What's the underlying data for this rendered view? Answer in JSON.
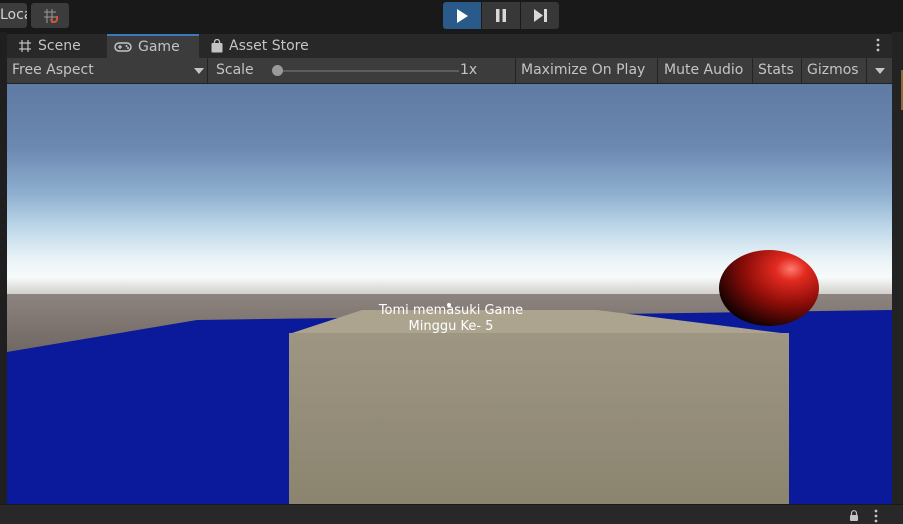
{
  "toolbar": {
    "pivot_label": "Local",
    "grid_snap_icon": "grid-snap-icon",
    "play_icon": "play-icon",
    "pause_icon": "pause-icon",
    "step_icon": "step-icon",
    "play_active_color": "#2a5a8a"
  },
  "tabs": [
    {
      "label": "Scene",
      "icon": "scene-grid-icon",
      "active": false
    },
    {
      "label": "Game",
      "icon": "gamepad-icon",
      "active": true
    },
    {
      "label": "Asset Store",
      "icon": "shopping-bag-icon",
      "active": false
    }
  ],
  "controls": {
    "aspect": "Free Aspect",
    "scale_label": "Scale",
    "scale_value": "1x",
    "scale_fraction": 0.0,
    "maximize": "Maximize On Play",
    "mute": "Mute Audio",
    "stats": "Stats",
    "gizmos": "Gizmos"
  },
  "game": {
    "overlay_line1": "Tomi memasuki Game",
    "overlay_line2": "Minggu Ke- 5",
    "ground_color": "#0b1a9a",
    "cube_color": "#9c9482",
    "sphere_color": "#d02018"
  },
  "bottom": {
    "lock_icon": "lock-icon",
    "menu_icon": "kebab-menu-icon"
  }
}
